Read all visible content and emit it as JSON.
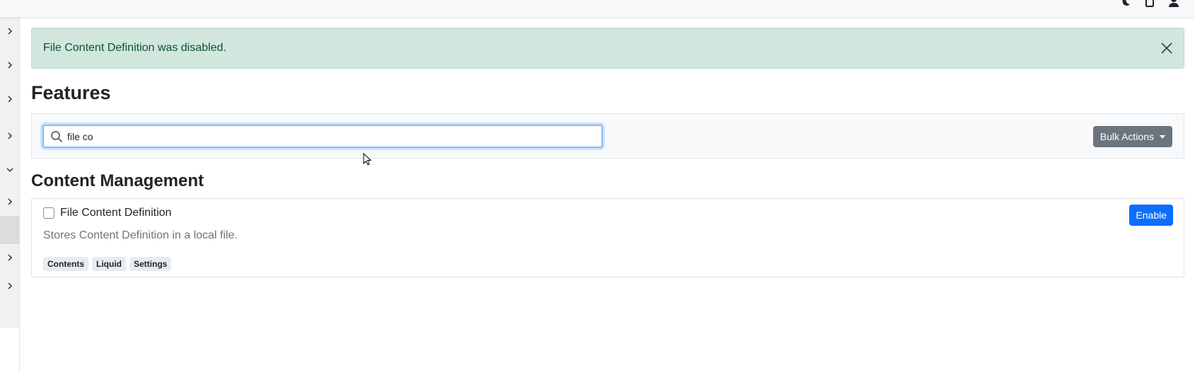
{
  "alert": {
    "message": "File Content Definition was disabled."
  },
  "page": {
    "title": "Features"
  },
  "toolbar": {
    "search_value": "file co",
    "bulk_actions_label": "Bulk Actions"
  },
  "section": {
    "title": "Content Management"
  },
  "feature": {
    "name": "File Content Definition",
    "description": "Stores Content Definition in a local file.",
    "checked": false,
    "enable_label": "Enable",
    "tags": [
      "Contents",
      "Liquid",
      "Settings"
    ]
  },
  "sidebar": {
    "items": [
      {
        "icon": "chevron-right-icon"
      },
      {
        "icon": "chevron-right-icon"
      },
      {
        "icon": "chevron-right-icon"
      },
      {
        "icon": "chevron-right-icon"
      },
      {
        "icon": "chevron-down-icon"
      },
      {
        "icon": "chevron-right-icon"
      },
      {
        "icon": "active-item"
      },
      {
        "icon": "chevron-right-icon"
      },
      {
        "icon": "chevron-right-icon"
      }
    ]
  },
  "topbar": {
    "icons": [
      "theme-toggle-icon",
      "document-icon",
      "user-icon"
    ]
  },
  "colors": {
    "alert_bg": "#d1e7dd",
    "alert_text": "#0f5132",
    "primary": "#0d6efd",
    "secondary": "#6c757d"
  }
}
